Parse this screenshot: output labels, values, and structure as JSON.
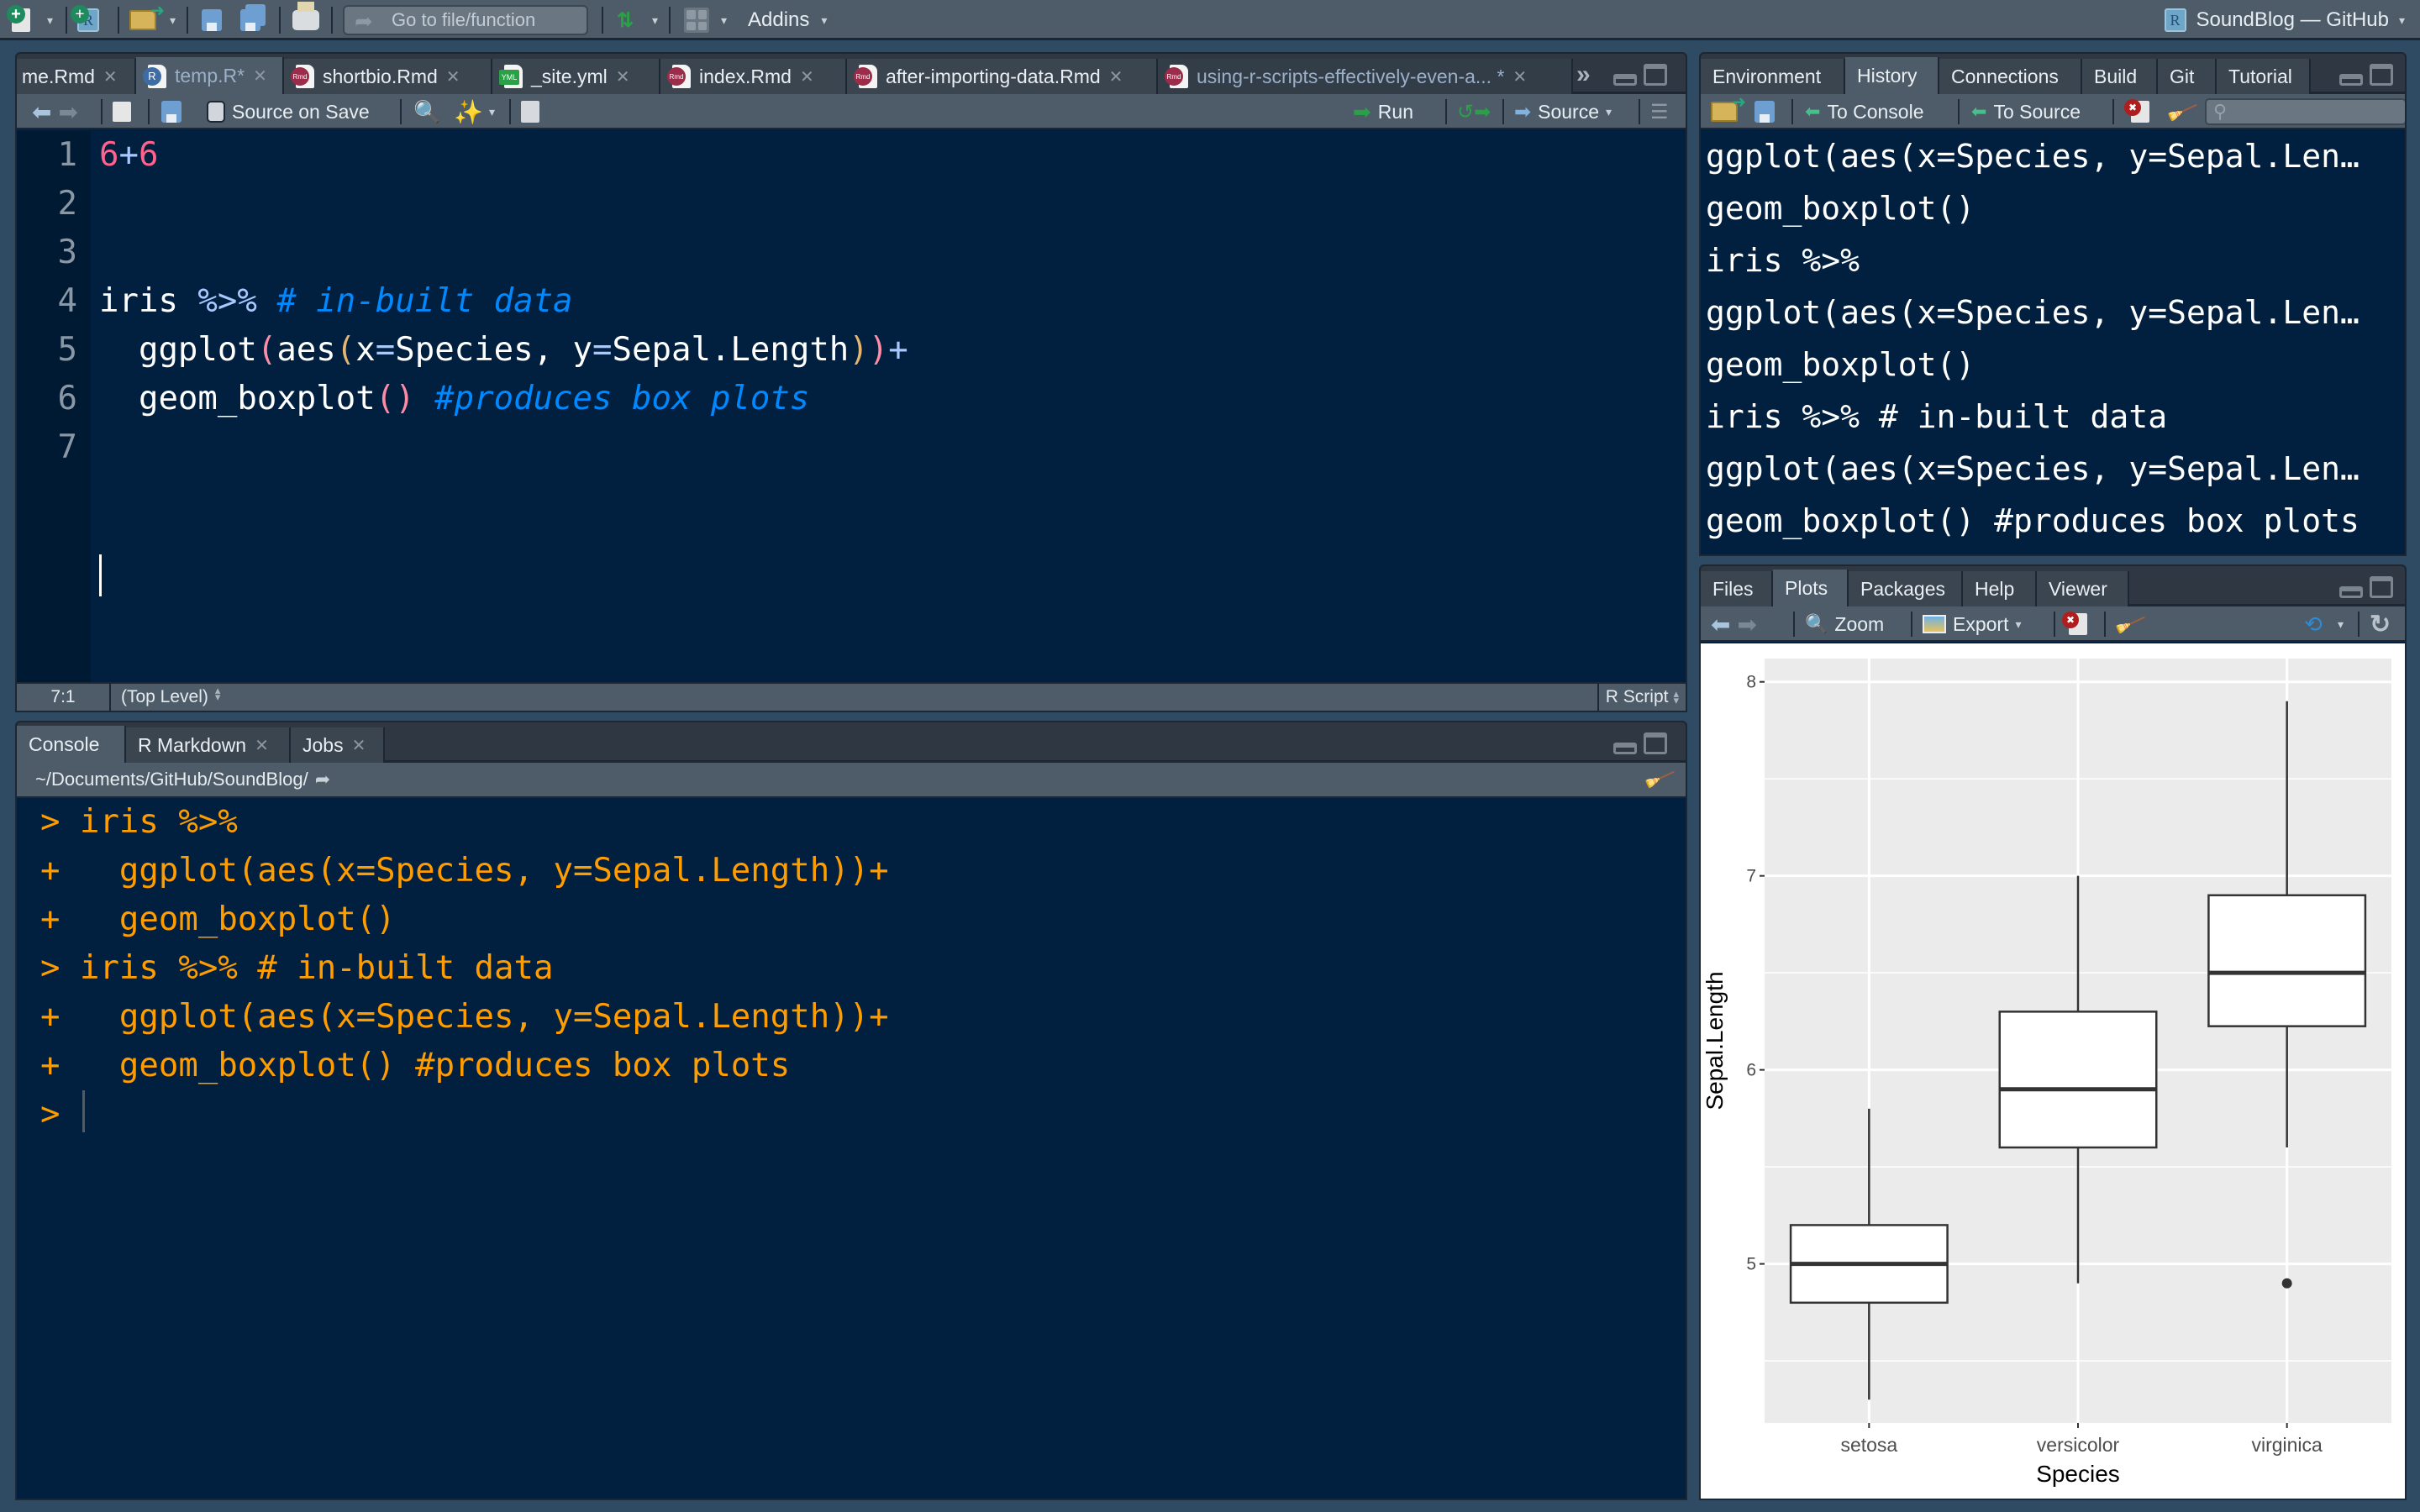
{
  "app": {
    "project_label": "SoundBlog — GitHub"
  },
  "top_toolbar": {
    "goto_placeholder": "Go to file/function",
    "addins_label": "Addins",
    "icons": [
      "new-file-icon",
      "new-project-icon",
      "open-file-icon",
      "save-icon",
      "save-all-icon",
      "print-icon",
      "go-to-icon",
      "vcs-icon",
      "workspace-panes-icon"
    ]
  },
  "editor": {
    "tabs": [
      {
        "label": "me.Rmd",
        "icon": "rmd-file-icon",
        "active": false
      },
      {
        "label": "temp.R*",
        "icon": "r-file-icon",
        "active": true
      },
      {
        "label": "shortbio.Rmd",
        "icon": "rmd-file-icon",
        "active": false
      },
      {
        "label": "_site.yml",
        "icon": "yml-file-icon",
        "active": false
      },
      {
        "label": "index.Rmd",
        "icon": "rmd-file-icon",
        "active": false
      },
      {
        "label": "after-importing-data.Rmd",
        "icon": "rmd-file-icon",
        "active": false
      },
      {
        "label": "using-r-scripts-effectively-even-a... *",
        "icon": "rmd-file-icon",
        "active": false
      }
    ],
    "tab_overflow": "»",
    "toolbar": {
      "source_on_save": "Source on Save",
      "source_on_save_checked": false,
      "run_label": "Run",
      "source_label": "Source"
    },
    "line_numbers": [
      "1",
      "2",
      "3",
      "4",
      "5",
      "6",
      "7"
    ],
    "lines": [
      [
        {
          "t": "6",
          "c": "num"
        },
        {
          "t": "+",
          "c": "op"
        },
        {
          "t": "6",
          "c": "num"
        }
      ],
      [],
      [],
      [
        {
          "t": "iris ",
          "c": "txt"
        },
        {
          "t": "%>%",
          "c": "op"
        },
        {
          "t": " # in-built data",
          "c": "cmt"
        }
      ],
      [
        {
          "t": "  ggplot",
          "c": "txt"
        },
        {
          "t": "(",
          "c": "p1"
        },
        {
          "t": "aes",
          "c": "txt"
        },
        {
          "t": "(",
          "c": "p2"
        },
        {
          "t": "x",
          "c": "txt"
        },
        {
          "t": "=",
          "c": "op"
        },
        {
          "t": "Species, y",
          "c": "txt"
        },
        {
          "t": "=",
          "c": "op"
        },
        {
          "t": "Sepal.Length",
          "c": "txt"
        },
        {
          "t": ")",
          "c": "p2"
        },
        {
          "t": ")",
          "c": "p1"
        },
        {
          "t": "+",
          "c": "op"
        }
      ],
      [
        {
          "t": "  geom_boxplot",
          "c": "txt"
        },
        {
          "t": "()",
          "c": "p1"
        },
        {
          "t": " #produces box plots",
          "c": "cmt"
        }
      ],
      []
    ],
    "status": {
      "cursor_pos": "7:1",
      "scope": "(Top Level)",
      "file_type": "R Script"
    }
  },
  "console": {
    "tabs": [
      {
        "label": "Console",
        "active": true,
        "closable": false
      },
      {
        "label": "R Markdown",
        "active": false,
        "closable": true
      },
      {
        "label": "Jobs",
        "active": false,
        "closable": true
      }
    ],
    "working_dir": "~/Documents/GitHub/SoundBlog/",
    "lines": [
      "> iris %>%",
      "+   ggplot(aes(x=Species, y=Sepal.Length))+",
      "+   geom_boxplot()",
      "> iris %>% # in-built data",
      "+   ggplot(aes(x=Species, y=Sepal.Length))+",
      "+   geom_boxplot() #produces box plots",
      "> "
    ]
  },
  "right_top": {
    "tabs": [
      {
        "label": "Environment",
        "active": false
      },
      {
        "label": "History",
        "active": true
      },
      {
        "label": "Connections",
        "active": false
      },
      {
        "label": "Build",
        "active": false
      },
      {
        "label": "Git",
        "active": false
      },
      {
        "label": "Tutorial",
        "active": false
      }
    ],
    "toolbar": {
      "to_console": "To Console",
      "to_source": "To Source",
      "search_placeholder": ""
    },
    "history": [
      "ggplot(aes(x=Species, y=Sepal.Len…",
      "geom_boxplot()",
      "iris %>%",
      "ggplot(aes(x=Species, y=Sepal.Len…",
      "geom_boxplot()",
      "iris %>% # in-built data",
      "ggplot(aes(x=Species, y=Sepal.Len…",
      "geom_boxplot() #produces box plots"
    ]
  },
  "right_bottom": {
    "tabs": [
      {
        "label": "Files",
        "active": false
      },
      {
        "label": "Plots",
        "active": true
      },
      {
        "label": "Packages",
        "active": false
      },
      {
        "label": "Help",
        "active": false
      },
      {
        "label": "Viewer",
        "active": false
      }
    ],
    "toolbar": {
      "zoom_label": "Zoom",
      "export_label": "Export"
    }
  },
  "chart_data": {
    "type": "boxplot",
    "title": "",
    "xlabel": "Species",
    "ylabel": "Sepal.Length",
    "categories": [
      "setosa",
      "versicolor",
      "virginica"
    ],
    "boxes": [
      {
        "category": "setosa",
        "whisker_low": 4.3,
        "q1": 4.8,
        "median": 5.0,
        "q3": 5.2,
        "whisker_high": 5.8,
        "outliers": []
      },
      {
        "category": "versicolor",
        "whisker_low": 4.9,
        "q1": 5.6,
        "median": 5.9,
        "q3": 6.3,
        "whisker_high": 7.0,
        "outliers": []
      },
      {
        "category": "virginica",
        "whisker_low": 5.6,
        "q1": 6.225,
        "median": 6.5,
        "q3": 6.9,
        "whisker_high": 7.9,
        "outliers": [
          4.9
        ]
      }
    ],
    "yticks": [
      5,
      6,
      7,
      8
    ],
    "ylim": [
      4.18,
      8.12
    ],
    "grid": true,
    "colors": {
      "panel_bg": "#EBEBEB",
      "grid": "#FFFFFF",
      "box_fill": "#FFFFFF",
      "stroke": "#333333"
    }
  }
}
